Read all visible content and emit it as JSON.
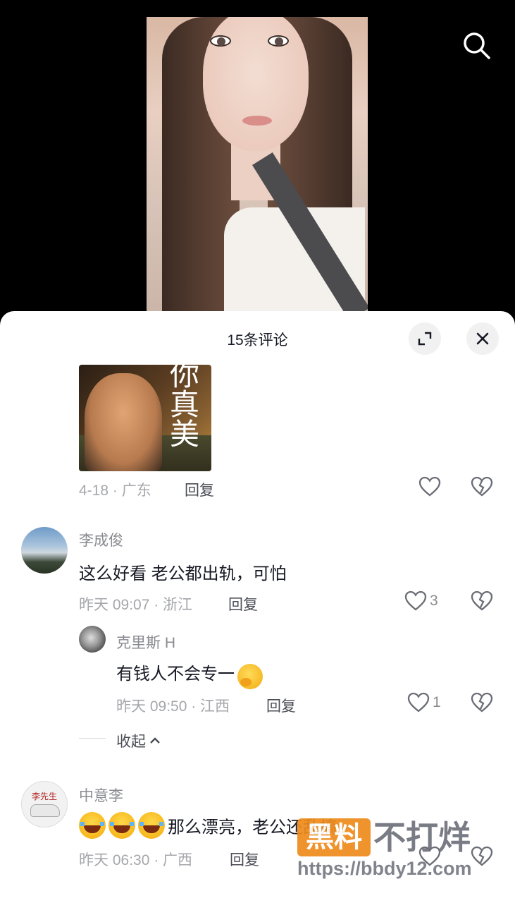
{
  "header": {
    "title": "15条评论"
  },
  "comments": [
    {
      "meta": "4-18 · 广东",
      "reply_label": "回复",
      "sticker_text": "你真美",
      "likes": ""
    },
    {
      "username": "李成俊",
      "text": "这么好看 老公都出轨，可怕",
      "meta": "昨天 09:07 · 浙江",
      "reply_label": "回复",
      "likes": "3"
    },
    {
      "username": "克里斯 H",
      "text": "有钱人不会专一",
      "meta": "昨天 09:50 · 江西",
      "reply_label": "回复",
      "likes": "1"
    },
    {
      "username": "中意李",
      "text": "那么漂亮，老公还乱搞",
      "meta": "昨天 06:30 · 广西",
      "reply_label": "回复",
      "likes": ""
    }
  ],
  "collapse_label": "收起",
  "avatar_text": "李先生",
  "watermark": {
    "badge": "黑料",
    "text": "不打烊",
    "url": "https://bbdy12.com"
  },
  "icons": {
    "search": "search-icon",
    "expand": "expand-icon",
    "close": "close-icon",
    "like": "heart-icon",
    "dislike": "broken-heart-icon",
    "collapse": "chevron-up-icon"
  },
  "colors": {
    "text_primary": "#161823",
    "text_secondary": "#8a8b91",
    "meta": "#a6a7ab",
    "watermark_orange": "#ee8a1c"
  }
}
